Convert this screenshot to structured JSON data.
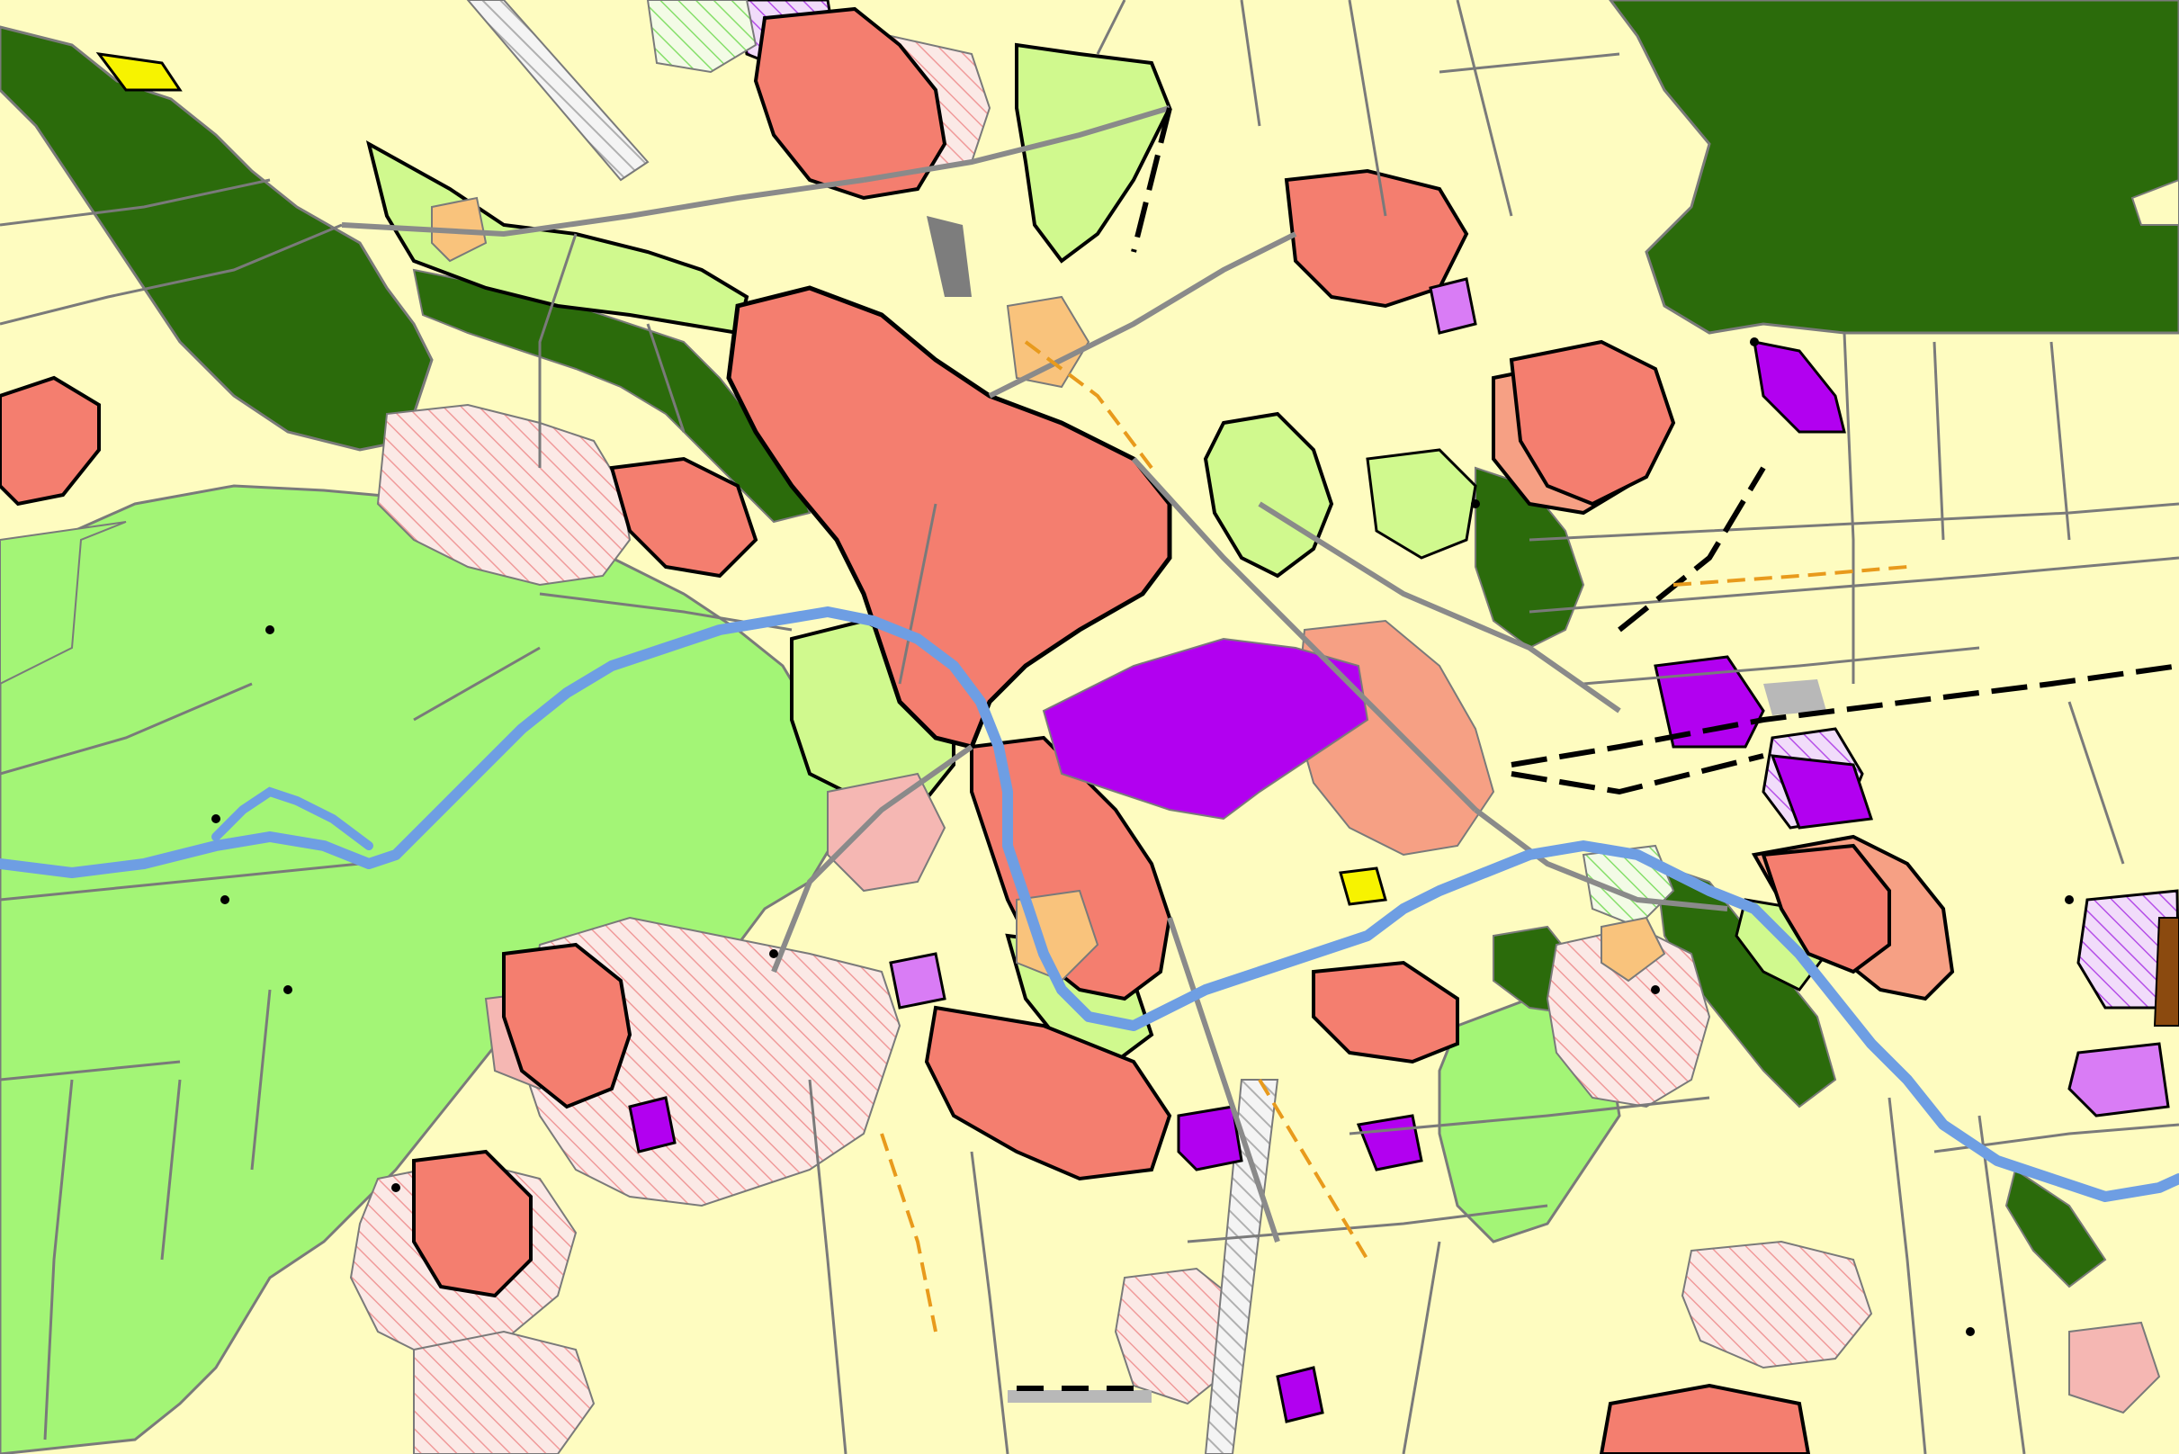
{
  "map": {
    "kind": "land-use-zoning-plan",
    "zones": [
      {
        "id": "agricultural",
        "color": "#fefcc0"
      },
      {
        "id": "forest",
        "color": "#2b6b0b"
      },
      {
        "id": "greenland",
        "color": "#a3f576"
      },
      {
        "id": "garden-green",
        "color": "#d0f98e"
      },
      {
        "id": "residential-dense",
        "color": "#f47e6f"
      },
      {
        "id": "residential-suburban",
        "color": "#f6a084"
      },
      {
        "id": "residential-low",
        "color": "#f5b7b3"
      },
      {
        "id": "commercial",
        "color": "#b200f0"
      },
      {
        "id": "commercial-light",
        "color": "#d97cf5"
      },
      {
        "id": "public-facility",
        "color": "#f9c37c"
      },
      {
        "id": "technical",
        "color": "#f7f300"
      },
      {
        "id": "water",
        "color": "#6e9ee3"
      },
      {
        "id": "transport",
        "color": "#7d7d7d"
      },
      {
        "id": "mining",
        "color": "#8b4a0f"
      }
    ],
    "hatched_zones": [
      {
        "id": "planned-residential",
        "color": "#f2a0a0"
      },
      {
        "id": "planned-commercial",
        "color": "#b54ee8"
      },
      {
        "id": "planned-green",
        "color": "#86df6a"
      },
      {
        "id": "planned-transport",
        "color": "#8a8a8a"
      }
    ],
    "line_styles": [
      {
        "id": "parcel-boundary",
        "color": "#7a7a7a"
      },
      {
        "id": "zone-boundary",
        "color": "#000000"
      },
      {
        "id": "planned-road",
        "color": "#e89a1c"
      },
      {
        "id": "railway",
        "color": "#000000"
      }
    ]
  }
}
